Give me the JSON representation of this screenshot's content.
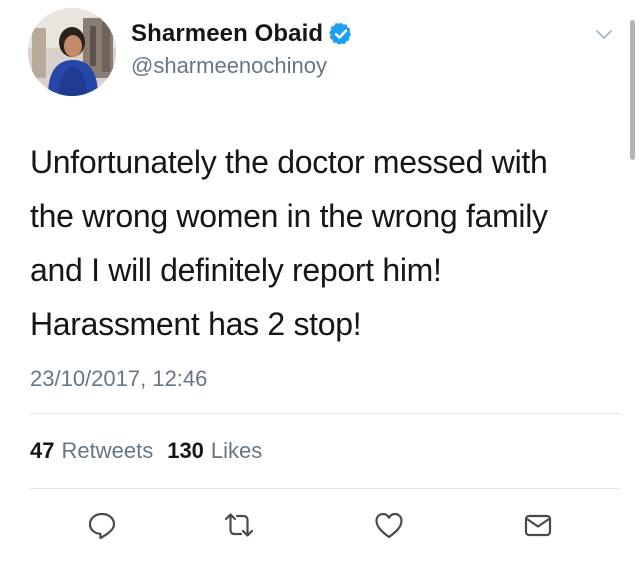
{
  "colors": {
    "verified": "#1da1f2",
    "secondary_text": "#657786",
    "primary_text": "#14171a",
    "divider": "#e1e8ed",
    "icon": "#4a4a4a"
  },
  "user": {
    "display_name": "Sharmeen Obaid",
    "verified": true,
    "handle": "@sharmeenochinoy",
    "avatar": "profile-photo"
  },
  "tweet": {
    "text_lines": [
      "Unfortunately the doctor messed with",
      "the wrong women in the wrong family",
      "and I will definitely report him!",
      "Harassment has 2 stop!"
    ],
    "timestamp": "23/10/2017, 12:46"
  },
  "stats": {
    "retweets_count": "47",
    "retweets_label": "Retweets",
    "likes_count": "130",
    "likes_label": "Likes"
  },
  "actions": {
    "icons": [
      "reply-icon",
      "retweet-icon",
      "like-icon",
      "direct-message-icon"
    ]
  }
}
